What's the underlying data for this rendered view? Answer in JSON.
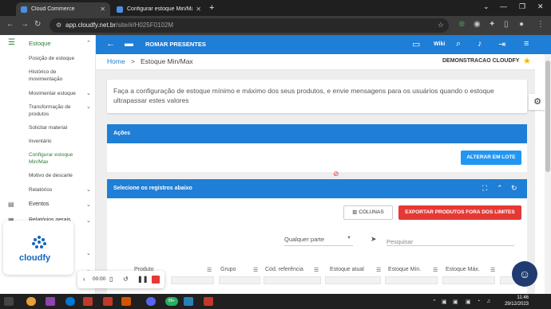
{
  "browser": {
    "tabs": [
      {
        "label": "Cloud Commerce",
        "active": true
      },
      {
        "label": "Configurar estoque Min/Ma",
        "active": false
      }
    ],
    "url_host": "app.cloudfy.net.br",
    "url_path": "/site/#/H025F0102M"
  },
  "sidebar": {
    "section": "Estoque",
    "items": [
      {
        "label": "Posição de estoque",
        "active": false,
        "has_children": false
      },
      {
        "label": "Histórico de movimentação",
        "active": false,
        "has_children": false
      },
      {
        "label": "Movimentar estoque",
        "active": false,
        "has_children": true
      },
      {
        "label": "Transformação de produtos",
        "active": false,
        "has_children": true
      },
      {
        "label": "Solicitar material",
        "active": false,
        "has_children": false
      },
      {
        "label": "Inventário",
        "active": false,
        "has_children": false
      },
      {
        "label": "Configurar estoque Min/Max",
        "active": true,
        "has_children": false
      },
      {
        "label": "Motivo de descarte",
        "active": false,
        "has_children": false
      },
      {
        "label": "Relatórios",
        "active": false,
        "has_children": true
      }
    ],
    "groups": [
      {
        "label": "Eventos"
      },
      {
        "label": "Relatórios gerais"
      }
    ]
  },
  "header": {
    "company": "ROMAR PRESENTES",
    "wiki": "Wiki"
  },
  "breadcrumb": {
    "home": "Home",
    "separator": ">",
    "page": "Estoque Min/Max",
    "account": "DEMONSTRACAO CLOUDFY"
  },
  "info": {
    "text": "Faça a configuração de estoque mínimo e máximo dos seus produtos, e envie mensagens para os usuários quando o estoque ultrapassar estes valores"
  },
  "actions_panel": {
    "title": "Ações",
    "button": "ALTERAR EM LOTE"
  },
  "records_panel": {
    "title": "Selecione os registros abaixo",
    "columns_button": "COLUNAS",
    "export_button": "EXPORTAR PRODUTOS FORA DOS LIMITES",
    "filter_value": "Qualquer parte",
    "search_placeholder": "Pesquisar",
    "columns": [
      "Produto",
      "Grupo",
      "Cód. referência",
      "Estoque atual",
      "Estoque Mín.",
      "Estoque Máx."
    ]
  },
  "logo": {
    "text": "cloudfy"
  },
  "recorder": {
    "time": "00:00"
  },
  "taskbar": {
    "time": "11:46",
    "date": "29/12/2023",
    "badge": "99+"
  },
  "colors": {
    "primary": "#1f7ed6",
    "accent_green": "#2e7d32",
    "danger": "#e53935",
    "button_blue": "#2196f3"
  }
}
